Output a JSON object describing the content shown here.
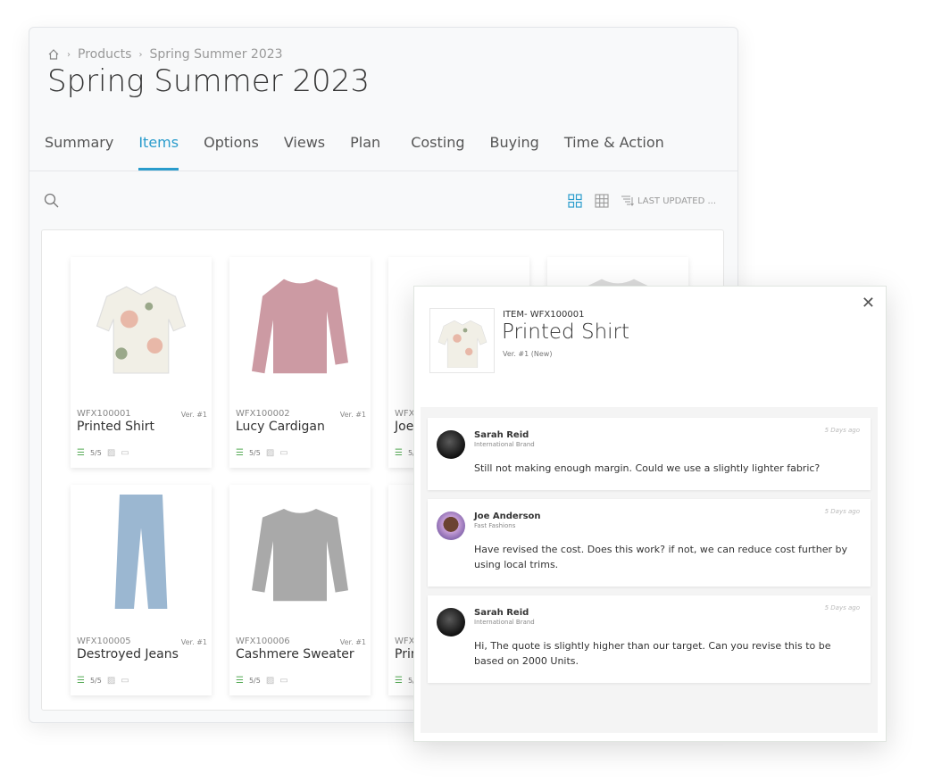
{
  "breadcrumb": {
    "items": [
      "Products",
      "Spring Summer 2023"
    ]
  },
  "page_title": "Spring Summer 2023",
  "tabs": [
    {
      "label": "Summary"
    },
    {
      "label": "Items",
      "active": true
    },
    {
      "label": "Options"
    },
    {
      "label": "Views"
    },
    {
      "label": "Plan"
    },
    {
      "label": "Costing"
    },
    {
      "label": "Buying"
    },
    {
      "label": "Time & Action"
    }
  ],
  "toolbar": {
    "sort_label": "LAST UPDATED ...",
    "accent": "#2a9ccc"
  },
  "items": [
    {
      "code": "WFX100001",
      "version": "Ver. #1",
      "name": "Printed Shirt",
      "progress": "5/5",
      "image": "printed-shirt"
    },
    {
      "code": "WFX100002",
      "version": "Ver. #1",
      "name": "Lucy Cardigan",
      "progress": "5/5",
      "image": "pink-sweater"
    },
    {
      "code": "WFX",
      "version": "",
      "name": "Joe",
      "progress": "5/5",
      "image": "partial"
    },
    {
      "code": "",
      "version": "",
      "name": "",
      "progress": "",
      "image": "white-tshirt"
    },
    {
      "code": "WFX100005",
      "version": "Ver. #1",
      "name": "Destroyed Jeans",
      "progress": "5/5",
      "image": "jeans"
    },
    {
      "code": "WFX100006",
      "version": "Ver. #1",
      "name": "Cashmere Sweater",
      "progress": "5/5",
      "image": "grey-sweater"
    },
    {
      "code": "WFX",
      "version": "",
      "name": "Prin",
      "progress": "5/5",
      "image": "partial"
    }
  ],
  "popup": {
    "item_code": "ITEM- WFX100001",
    "name": "Printed Shirt",
    "version": "Ver. #1 (New)",
    "comments": [
      {
        "author": "Sarah Reid",
        "org": "International Brand",
        "time": "5 Days ago",
        "text": "Still not making enough margin. Could we use a slightly lighter fabric?"
      },
      {
        "author": "Joe Anderson",
        "org": "Fast Fashions",
        "time": "5 Days ago",
        "text": "Have revised the cost. Does this work? if not, we can reduce cost further by using local trims."
      },
      {
        "author": "Sarah Reid",
        "org": "International Brand",
        "time": "5 Days ago",
        "text": "Hi, The quote is slightly higher than our target. Can you revise this to be based on 2000 Units."
      }
    ]
  }
}
